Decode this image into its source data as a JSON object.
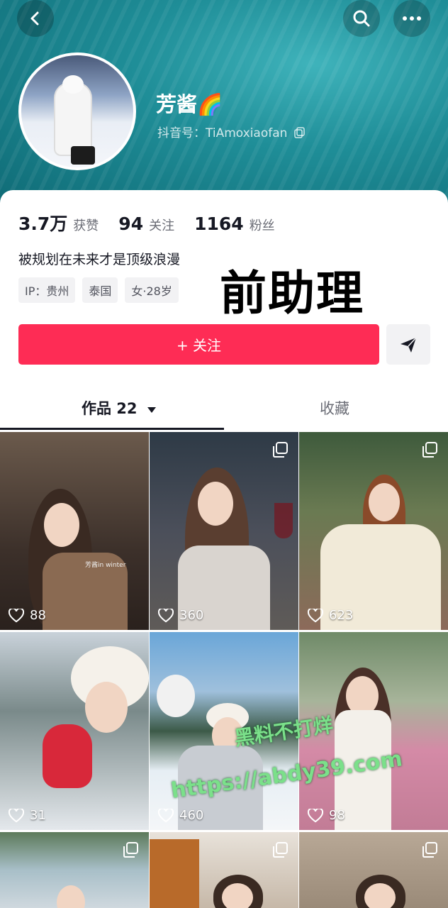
{
  "profile": {
    "username": "芳酱🌈",
    "douyin_id": "抖音号：TiAmoxiaofan",
    "bio": "被规划在未来才是顶级浪漫",
    "tags": [
      "IP：贵州",
      "泰国",
      "女·28岁"
    ],
    "overlay_text": "前助理"
  },
  "stats": {
    "likes_num": "3.7万",
    "likes_label": "获赞",
    "following_num": "94",
    "following_label": "关注",
    "followers_num": "1164",
    "followers_label": "粉丝"
  },
  "actions": {
    "follow_label": "+ 关注"
  },
  "tabs": {
    "works_label": "作品 22",
    "favorites_label": "收藏"
  },
  "posts": [
    {
      "likes": "88",
      "caption": "芳酱in winter"
    },
    {
      "likes": "360"
    },
    {
      "likes": "623"
    },
    {
      "likes": "31"
    },
    {
      "likes": "460"
    },
    {
      "likes": "98"
    },
    {
      "likes": ""
    },
    {
      "likes": ""
    },
    {
      "likes": ""
    }
  ],
  "watermark": {
    "zh": "黑料不打烊",
    "url": "https://abdy39.com"
  },
  "icons": {
    "back": "back-icon",
    "search": "search-icon",
    "more": "more-icon",
    "copy": "copy-icon",
    "share": "send-icon",
    "heart": "heart-icon",
    "multi": "multi-image-icon",
    "dropdown": "caret-down-icon"
  },
  "colors": {
    "accent": "#fe2c55",
    "header": "#1f8e98"
  }
}
